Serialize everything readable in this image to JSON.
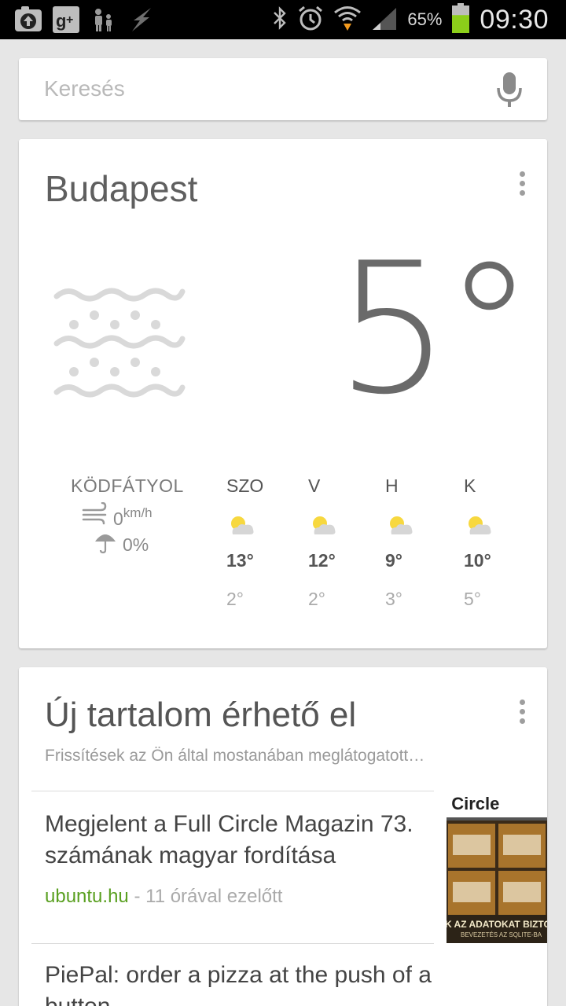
{
  "status_bar": {
    "left_icons": [
      "upload-icon",
      "google-plus-icon",
      "parental-icon",
      "flash-icon"
    ],
    "right_icons": [
      "bluetooth-icon",
      "alarm-icon",
      "wifi-icon",
      "signal-icon",
      "battery-icon"
    ],
    "battery_percent": "65%",
    "battery_level": 0.65,
    "time": "09:30"
  },
  "search": {
    "placeholder": "Keresés",
    "mic_icon": "microphone-icon"
  },
  "weather": {
    "city": "Budapest",
    "current_temp": "5°",
    "condition": "KÖDFÁTYOL",
    "condition_icon": "fog-icon",
    "wind_value": "0",
    "wind_unit": "km/h",
    "rain": "0%",
    "forecast": [
      {
        "day": "SZO",
        "high": "13°",
        "low": "2°",
        "icon": "partly-cloudy-icon"
      },
      {
        "day": "V",
        "high": "12°",
        "low": "2°",
        "icon": "partly-cloudy-icon"
      },
      {
        "day": "H",
        "high": "9°",
        "low": "3°",
        "icon": "partly-cloudy-icon"
      },
      {
        "day": "K",
        "high": "10°",
        "low": "5°",
        "icon": "partly-cloudy-icon"
      }
    ],
    "colors": {
      "sun": "#f7d83f",
      "cloud": "#d6d6d6"
    }
  },
  "new_content": {
    "title": "Új tartalom érhető el",
    "subtitle": "Frissítések az Ön által mostanában meglátogatott…",
    "articles": [
      {
        "title": "Megjelent a Full Circle Magazin 73. számának magyar fordítása",
        "source": "ubuntu.hu",
        "time": "11 órával ezelőtt",
        "thumb_heading": "l Circle",
        "thumb_banner": "K AZ ADATOKAT BIZTON",
        "thumb_caption": "BEVEZETÉS AZ SQLITE-BA"
      },
      {
        "title": "PiePal: order a pizza at the push of a button"
      }
    ],
    "colors": {
      "source": "#5aa021"
    }
  }
}
